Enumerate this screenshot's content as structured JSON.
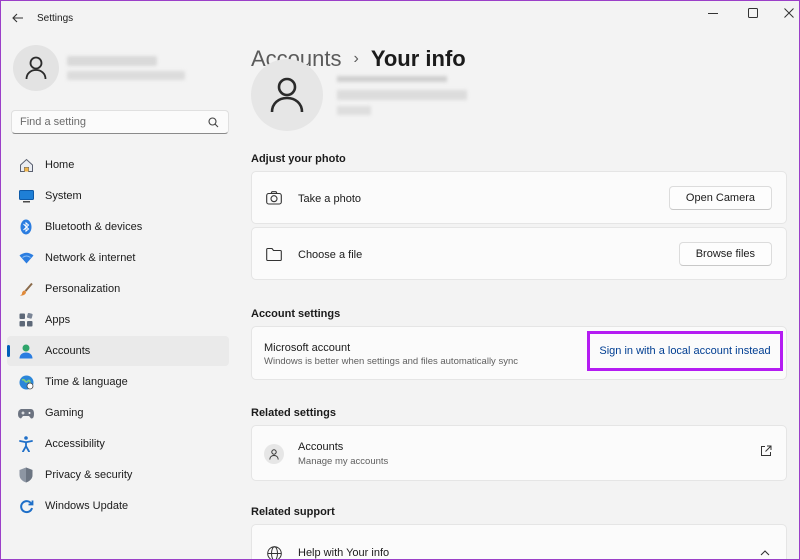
{
  "window": {
    "app_title": "Settings"
  },
  "sidebar": {
    "search_placeholder": "Find a setting",
    "items": [
      {
        "label": "Home",
        "icon": "home-icon"
      },
      {
        "label": "System",
        "icon": "system-icon"
      },
      {
        "label": "Bluetooth & devices",
        "icon": "bluetooth-icon"
      },
      {
        "label": "Network & internet",
        "icon": "network-icon"
      },
      {
        "label": "Personalization",
        "icon": "brush-icon"
      },
      {
        "label": "Apps",
        "icon": "apps-icon"
      },
      {
        "label": "Accounts",
        "icon": "accounts-icon",
        "active": true
      },
      {
        "label": "Time & language",
        "icon": "globe-icon"
      },
      {
        "label": "Gaming",
        "icon": "gamepad-icon"
      },
      {
        "label": "Accessibility",
        "icon": "accessibility-icon"
      },
      {
        "label": "Privacy & security",
        "icon": "shield-icon"
      },
      {
        "label": "Windows Update",
        "icon": "update-icon"
      }
    ]
  },
  "main": {
    "breadcrumb": {
      "parent": "Accounts",
      "separator": "›",
      "current": "Your info"
    },
    "adjust_photo": {
      "title": "Adjust your photo",
      "take_photo": {
        "label": "Take a photo",
        "button": "Open Camera"
      },
      "choose_file": {
        "label": "Choose a file",
        "button": "Browse files"
      }
    },
    "account_settings": {
      "title": "Account settings",
      "ms_title": "Microsoft account",
      "ms_sub": "Windows is better when settings and files automatically sync",
      "link": "Sign in with a local account instead"
    },
    "related_settings": {
      "title": "Related settings",
      "accounts_title": "Accounts",
      "accounts_sub": "Manage my accounts"
    },
    "related_support": {
      "title": "Related support",
      "help_title": "Help with Your info"
    }
  },
  "colors": {
    "accent": "#005fb8",
    "highlight_border": "#b41cf2",
    "link": "#003e92"
  }
}
